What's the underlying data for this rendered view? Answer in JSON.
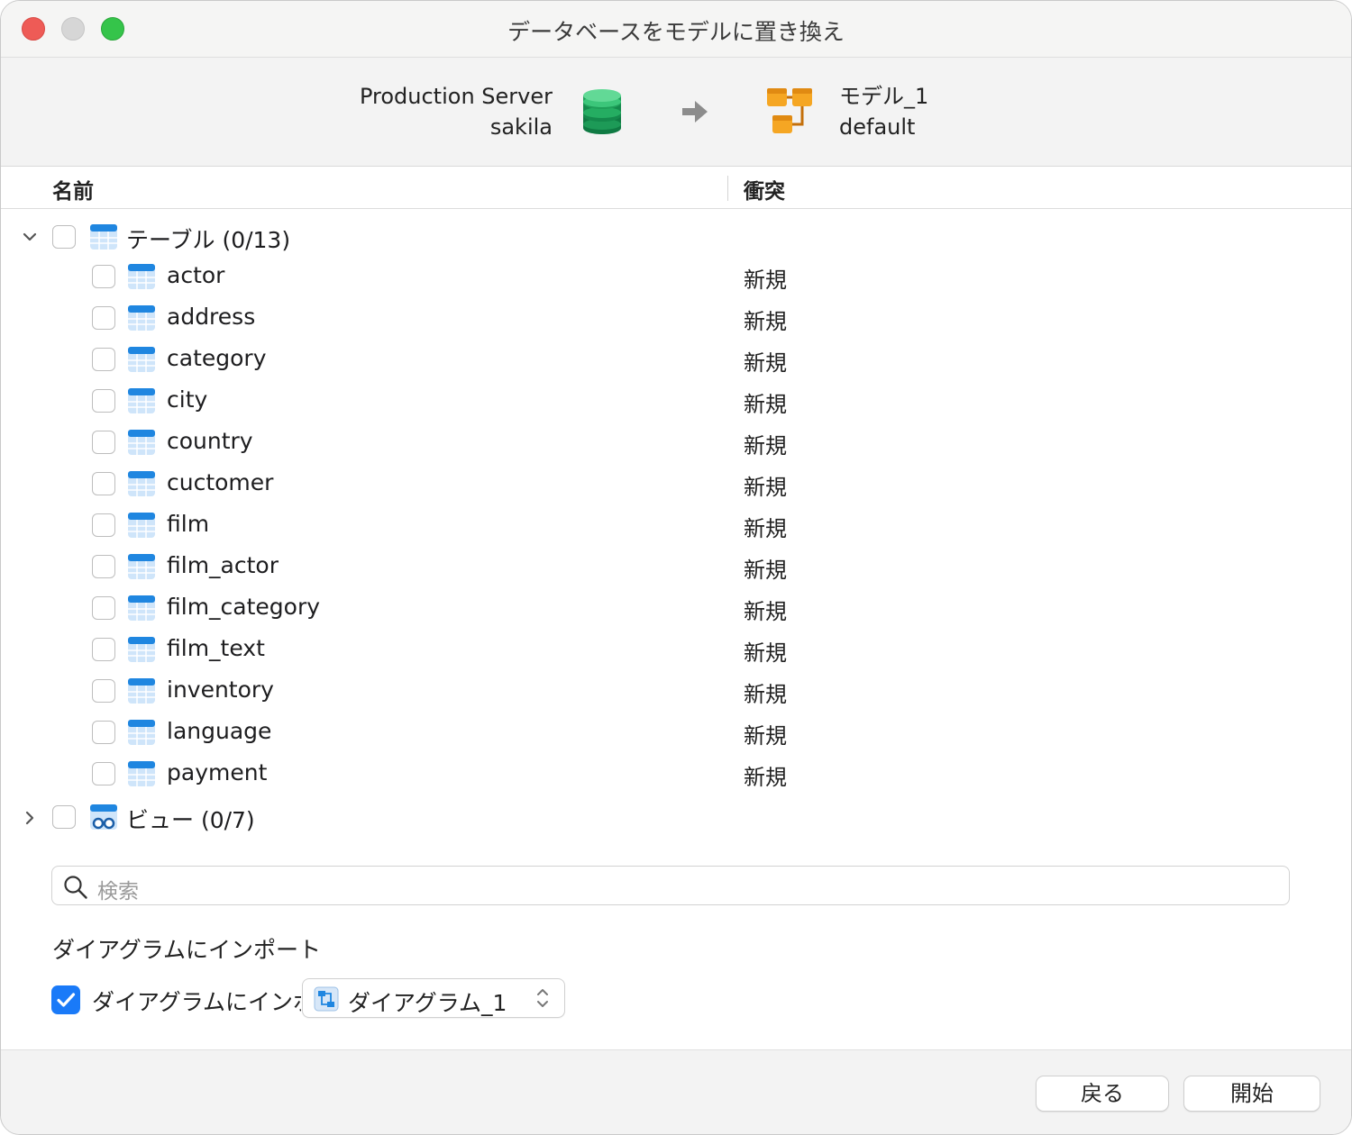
{
  "window": {
    "title": "データベースをモデルに置き換え"
  },
  "header": {
    "source": {
      "server": "Production Server",
      "database": "sakila"
    },
    "target": {
      "model": "モデル_1",
      "schema": "default"
    }
  },
  "columns": {
    "name": "名前",
    "conflict": "衝突"
  },
  "tree": {
    "tables_group": {
      "label": "テーブル (0/13)",
      "expanded": true
    },
    "tables": [
      {
        "name": "actor",
        "conflict": "新規"
      },
      {
        "name": "address",
        "conflict": "新規"
      },
      {
        "name": "category",
        "conflict": "新規"
      },
      {
        "name": "city",
        "conflict": "新規"
      },
      {
        "name": "country",
        "conflict": "新規"
      },
      {
        "name": "cuctomer",
        "conflict": "新規"
      },
      {
        "name": "film",
        "conflict": "新規"
      },
      {
        "name": "film_actor",
        "conflict": "新規"
      },
      {
        "name": "film_category",
        "conflict": "新規"
      },
      {
        "name": "film_text",
        "conflict": "新規"
      },
      {
        "name": "inventory",
        "conflict": "新規"
      },
      {
        "name": "language",
        "conflict": "新規"
      },
      {
        "name": "payment",
        "conflict": "新規"
      }
    ],
    "views_group": {
      "label": "ビュー (0/7)",
      "expanded": false
    }
  },
  "search": {
    "placeholder": "検索"
  },
  "import": {
    "section_title": "ダイアグラムにインポート",
    "checkbox_label": "ダイアグラムにインポート",
    "checked": true,
    "diagram_selected": "ダイアグラム_1"
  },
  "buttons": {
    "back": "戻る",
    "start": "開始"
  },
  "colors": {
    "accent": "#1a7af8",
    "db_green": "#1f9a56",
    "model_orange": "#f5a623",
    "table_blue": "#2d8fe0"
  }
}
